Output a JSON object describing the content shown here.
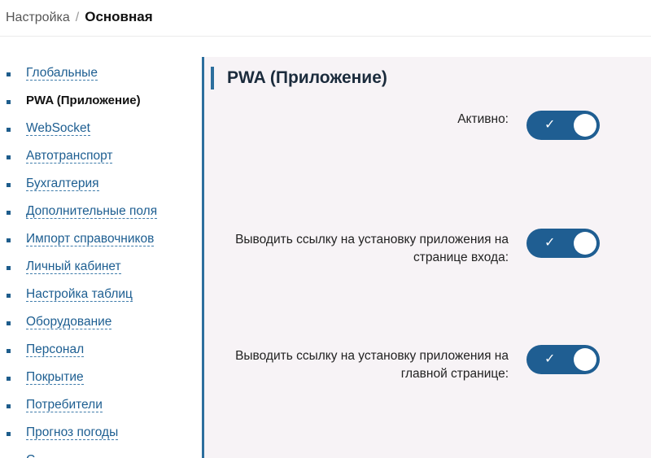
{
  "breadcrumb": {
    "parent": "Настройка",
    "separator": "/",
    "current": "Основная"
  },
  "sidebar": {
    "items": [
      {
        "label": "Глобальные",
        "active": false
      },
      {
        "label": "PWA (Приложение)",
        "active": true
      },
      {
        "label": "WebSocket",
        "active": false
      },
      {
        "label": "Автотранспорт",
        "active": false
      },
      {
        "label": "Бухгалтерия",
        "active": false
      },
      {
        "label": "Дополнительные поля",
        "active": false
      },
      {
        "label": "Импорт справочников",
        "active": false
      },
      {
        "label": "Личный кабинет",
        "active": false
      },
      {
        "label": "Настройка таблиц",
        "active": false
      },
      {
        "label": "Оборудование",
        "active": false
      },
      {
        "label": "Персонал",
        "active": false
      },
      {
        "label": "Покрытие",
        "active": false
      },
      {
        "label": "Потребители",
        "active": false
      },
      {
        "label": "Прогноз погоды",
        "active": false
      },
      {
        "label": "С",
        "active": false
      }
    ]
  },
  "main": {
    "title": "PWA (Приложение)",
    "settings": [
      {
        "label": "Активно:",
        "enabled": true,
        "check": "✓"
      },
      {
        "label": "Выводить ссылку на установку приложения на странице входа:",
        "enabled": true,
        "check": "✓"
      },
      {
        "label": "Выводить ссылку на установку приложения на главной странице:",
        "enabled": true,
        "check": "✓"
      }
    ]
  },
  "colors": {
    "accent": "#1f5e92",
    "link": "#1d5e91",
    "panel_bg": "#f7f3f6"
  }
}
